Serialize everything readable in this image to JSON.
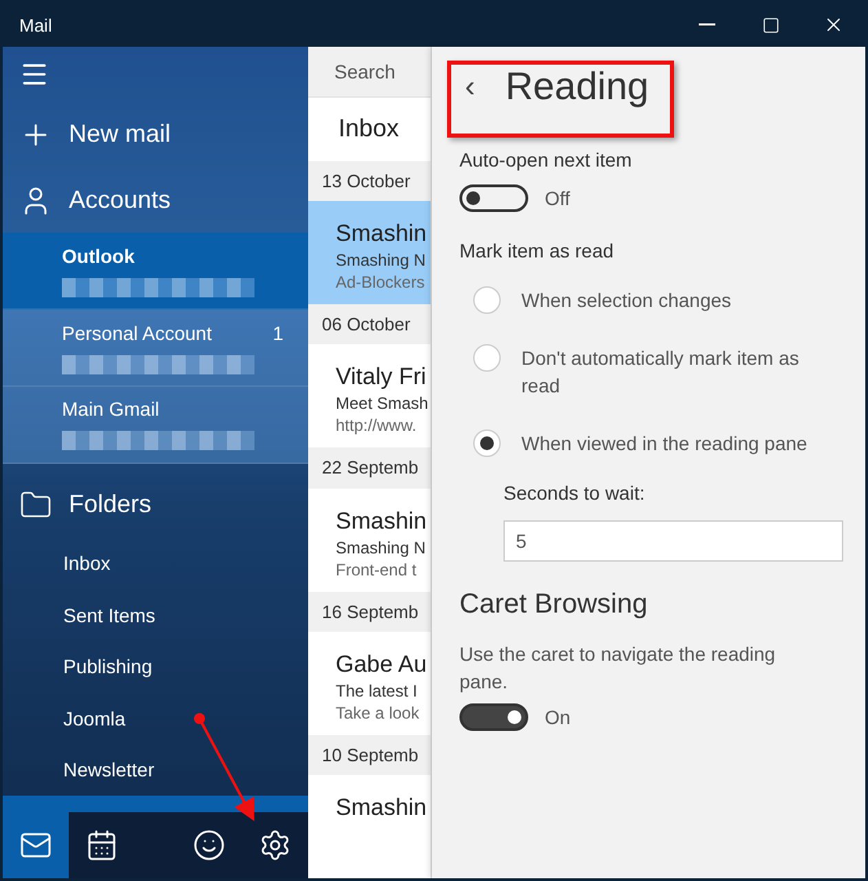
{
  "window": {
    "title": "Mail",
    "controls": [
      {
        "kind": "minimize"
      },
      {
        "kind": "maximize"
      },
      {
        "kind": "close"
      }
    ]
  },
  "sidebar": {
    "new_mail": "New mail",
    "accounts_label": "Accounts",
    "accounts": [
      {
        "name": "Outlook",
        "selected": true
      },
      {
        "name": "Personal Account",
        "selected": false,
        "count": "1"
      },
      {
        "name": "Main Gmail",
        "selected": false
      }
    ],
    "folders_label": "Folders",
    "folders": [
      "Inbox",
      "Sent Items",
      "Publishing",
      "Joomla",
      "Newsletter"
    ],
    "bottom_bar": [
      {
        "kind": "mail",
        "selected": true
      },
      {
        "kind": "calendar",
        "selected": false
      },
      {
        "kind": "smiley",
        "selected": false
      },
      {
        "kind": "settings",
        "selected": false
      }
    ]
  },
  "mail_list": {
    "search_placeholder": "Search",
    "folder_title": "Inbox",
    "groups": [
      {
        "date": "13 October",
        "messages": [
          {
            "sender": "Smashin",
            "subject": "Smashing N",
            "preview": "Ad-Blockers",
            "selected": true
          }
        ]
      },
      {
        "date": "06 October",
        "messages": [
          {
            "sender": "Vitaly Fri",
            "subject": "Meet Smash",
            "preview": "http://www.",
            "selected": false
          }
        ]
      },
      {
        "date": "22 Septemb",
        "messages": [
          {
            "sender": "Smashin",
            "subject": "Smashing N",
            "preview": "Front-end t",
            "selected": false
          }
        ]
      },
      {
        "date": "16 Septemb",
        "messages": [
          {
            "sender": "Gabe Au",
            "subject": "The latest I",
            "preview": "Take a look",
            "selected": false
          }
        ]
      },
      {
        "date": "10 Septemb",
        "messages": [
          {
            "sender": "Smashin",
            "selected": false
          }
        ]
      }
    ]
  },
  "settings": {
    "back": "‹",
    "title": "Reading",
    "auto_open": {
      "label": "Auto-open next item",
      "on": false,
      "state_text": "Off"
    },
    "mark_read": {
      "label": "Mark item as read",
      "options": [
        {
          "label": "When selection changes",
          "selected": false
        },
        {
          "label": "Don't automatically mark item as read",
          "selected": false
        },
        {
          "label": "When viewed in the reading pane",
          "selected": true
        }
      ],
      "seconds_label": "Seconds to wait:",
      "seconds_value": "5"
    },
    "caret": {
      "heading": "Caret Browsing",
      "description": "Use the caret to navigate the reading pane.",
      "on": true,
      "state_text": "On"
    }
  }
}
